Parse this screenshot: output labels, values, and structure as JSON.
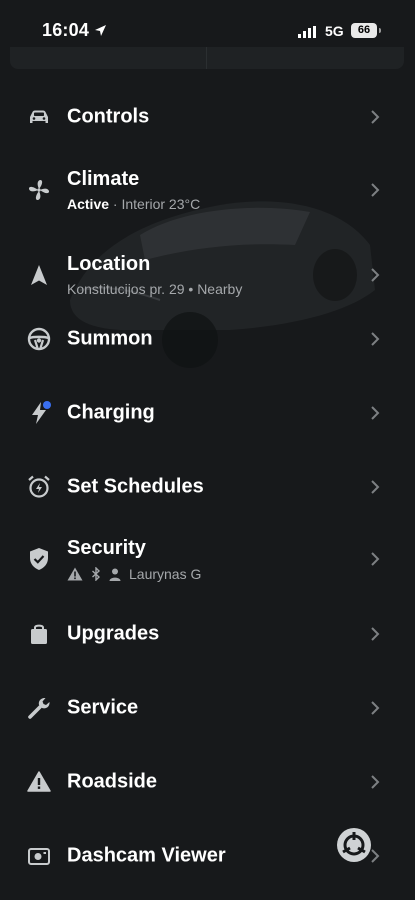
{
  "status_bar": {
    "time": "16:04",
    "network": "5G",
    "battery": "66"
  },
  "menu": {
    "items": [
      {
        "label": "Controls",
        "icon": "car-icon"
      },
      {
        "label": "Climate",
        "icon": "fan-icon",
        "sub_status": "Active",
        "sub_detail": " · Interior 23°C"
      },
      {
        "label": "Location",
        "icon": "navigation-arrow-icon",
        "sub": "Konstitucijos pr. 29 • Nearby"
      },
      {
        "label": "Summon",
        "icon": "steering-wheel-icon"
      },
      {
        "label": "Charging",
        "icon": "lightning-icon",
        "badge_color": "#3a6ff0"
      },
      {
        "label": "Set Schedules",
        "icon": "alarm-clock-icon"
      },
      {
        "label": "Security",
        "icon": "shield-check-icon",
        "sub_user": "Laurynas G"
      },
      {
        "label": "Upgrades",
        "icon": "shopping-bag-icon"
      },
      {
        "label": "Service",
        "icon": "wrench-icon"
      },
      {
        "label": "Roadside",
        "icon": "warning-triangle-icon"
      },
      {
        "label": "Dashcam Viewer",
        "icon": "dashcam-icon"
      }
    ]
  },
  "colors": {
    "background": "#17191b",
    "text_primary": "#ffffff",
    "text_secondary": "#a5a8ab",
    "icon": "#c8cbcd",
    "accent_dot": "#3a6ff0"
  }
}
